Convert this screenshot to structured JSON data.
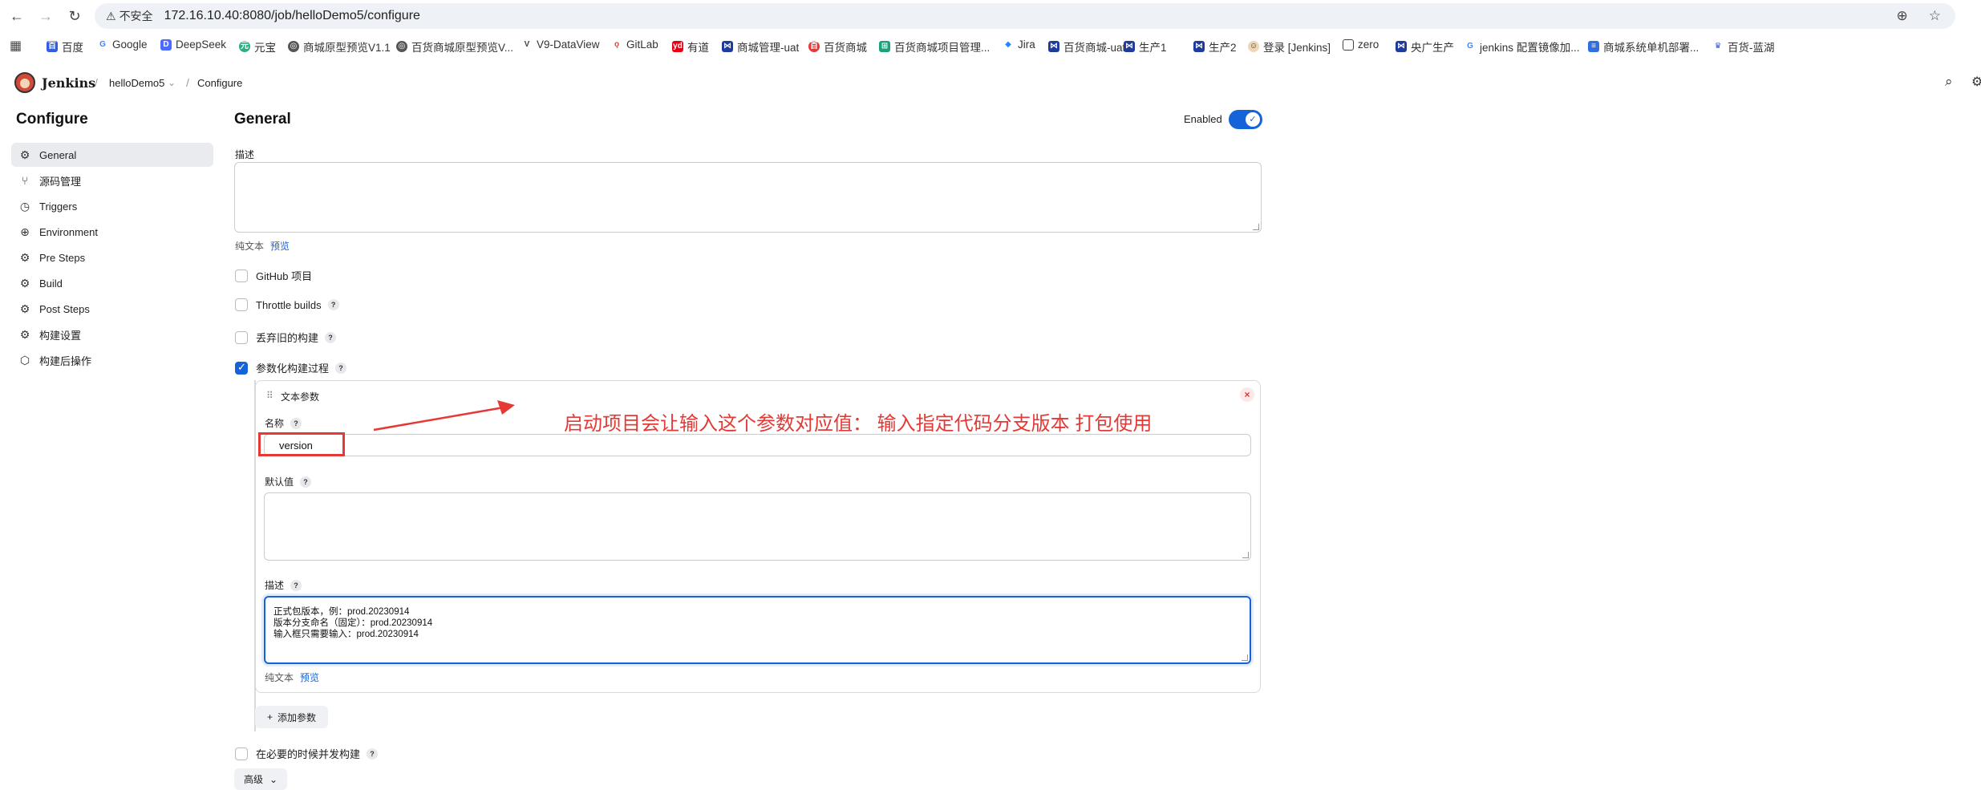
{
  "browser": {
    "insecure_label": "不安全",
    "url": "172.16.10.40:8080/job/helloDemo5/configure",
    "bookmarks": [
      "百度",
      "Google",
      "DeepSeek",
      "元宝",
      "商城原型预览V1.1",
      "百货商城原型预览V...",
      "V9-DataView",
      "GitLab",
      "有道",
      "商城管理-uat",
      "百货商城",
      "百货商城项目管理...",
      "Jira",
      "百货商城-uat",
      "生产1",
      "生产2",
      "登录 [Jenkins]",
      "zero",
      "央广生产",
      "jenkins 配置镜像加...",
      "商城系统单机部署...",
      "百货-蓝湖"
    ]
  },
  "header": {
    "app_name": "Jenkins",
    "breadcrumb_job": "helloDemo5",
    "breadcrumb_page": "Configure"
  },
  "sidebar": {
    "title": "Configure",
    "items": [
      {
        "label": "General",
        "icon": "gear-icon"
      },
      {
        "label": "源码管理",
        "icon": "branch-icon"
      },
      {
        "label": "Triggers",
        "icon": "clock-icon"
      },
      {
        "label": "Environment",
        "icon": "globe-icon"
      },
      {
        "label": "Pre Steps",
        "icon": "gear-icon"
      },
      {
        "label": "Build",
        "icon": "gear-icon"
      },
      {
        "label": "Post Steps",
        "icon": "gear-icon"
      },
      {
        "label": "构建设置",
        "icon": "gear-icon"
      },
      {
        "label": "构建后操作",
        "icon": "cube-icon"
      }
    ]
  },
  "main": {
    "title": "General",
    "enabled_label": "Enabled",
    "description_label": "描述",
    "plain_text": "纯文本",
    "preview": "预览",
    "checkboxes": [
      {
        "label": "GitHub 项目",
        "checked": false
      },
      {
        "label": "Throttle builds",
        "checked": false
      },
      {
        "label": "丢弃旧的构建",
        "checked": false
      },
      {
        "label": "参数化构建过程",
        "checked": true
      }
    ],
    "param": {
      "type": "文本参数",
      "name_label": "名称",
      "name_value": "version",
      "default_label": "默认值",
      "desc_label": "描述",
      "desc_lines": [
        "正式包版本，例：prod.20230914",
        "版本分支命名（固定）：prod.20230914",
        "输入框只需要输入：prod.20230914"
      ]
    },
    "add_param": "添加参数",
    "concurrent_label": "在必要的时候并发构建",
    "advanced": "高级"
  },
  "annotation": {
    "text": "启动项目会让输入这个参数对应值：  输入指定代码分支版本 打包使用"
  },
  "colors": {
    "accent": "#1463d9",
    "annotation_red": "#e53935"
  }
}
